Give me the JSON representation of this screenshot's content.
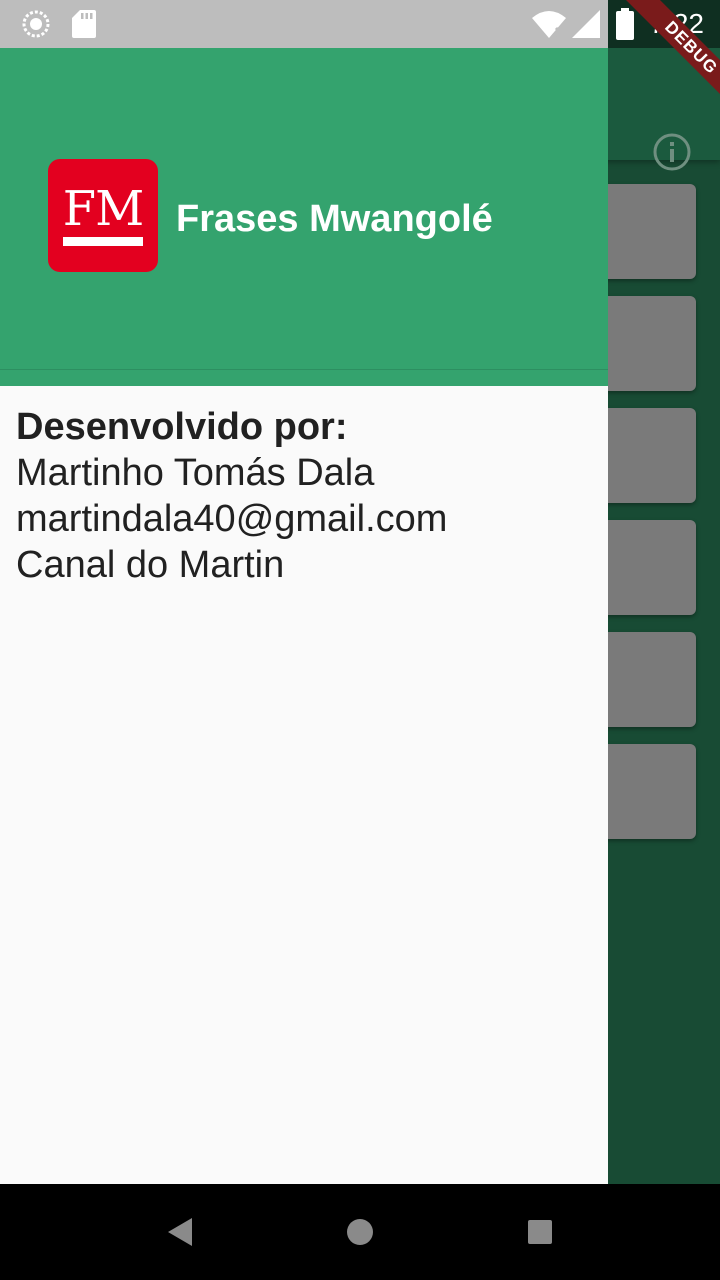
{
  "status_bar": {
    "time": "7:22",
    "left_icons": [
      "loading-circle-icon",
      "sd-card-icon"
    ],
    "right_icons": [
      "wifi-icon",
      "signal-icon",
      "battery-icon"
    ]
  },
  "debug_ribbon": "DEBUG",
  "background_app": {
    "appbar_action_icon": "info-icon",
    "card_count": 6
  },
  "drawer": {
    "header": {
      "logo_text": "FM",
      "title": "Frases Mwangolé"
    },
    "about": {
      "heading": "Desenvolvido por:",
      "name": "Martinho Tomás Dala",
      "email": "martindala40@gmail.com",
      "channel": "Canal do Martin"
    }
  },
  "nav_bar": {
    "buttons": [
      "back-icon",
      "home-icon",
      "recents-icon"
    ]
  },
  "colors": {
    "drawer_header": "#34a36e",
    "drawer_body": "#fafafa",
    "logo_red": "#e3001f",
    "scrim_bg": "#184b34"
  }
}
